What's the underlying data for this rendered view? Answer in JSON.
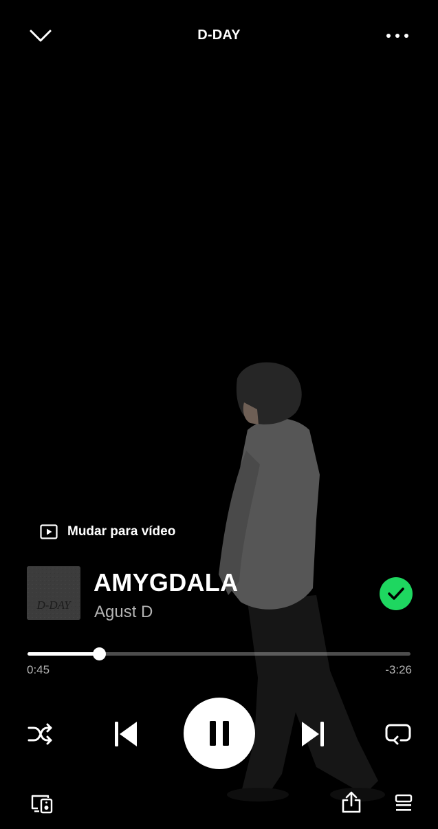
{
  "header": {
    "title": "D-DAY",
    "collapse_icon": "chevron-down-icon",
    "more_icon": "more-horizontal-icon"
  },
  "switch_to_video": {
    "label": "Mudar para vídeo",
    "icon": "video-play-icon"
  },
  "track": {
    "title": "AMYGDALA",
    "artist": "Agust D",
    "cover_text": "D-DAY",
    "saved": true
  },
  "progress": {
    "elapsed": "0:45",
    "remaining": "-3:26",
    "fraction": 0.186
  },
  "controls": {
    "shuffle_icon": "shuffle-icon",
    "previous_icon": "skip-previous-icon",
    "play_state": "playing",
    "pause_icon": "pause-icon",
    "next_icon": "skip-next-icon",
    "repeat_icon": "repeat-icon"
  },
  "bottom_bar": {
    "devices_icon": "connect-device-icon",
    "share_icon": "share-icon",
    "queue_icon": "queue-icon"
  },
  "colors": {
    "background": "#000000",
    "accent_green": "#1ed760",
    "secondary_text": "#b3b3b3"
  }
}
